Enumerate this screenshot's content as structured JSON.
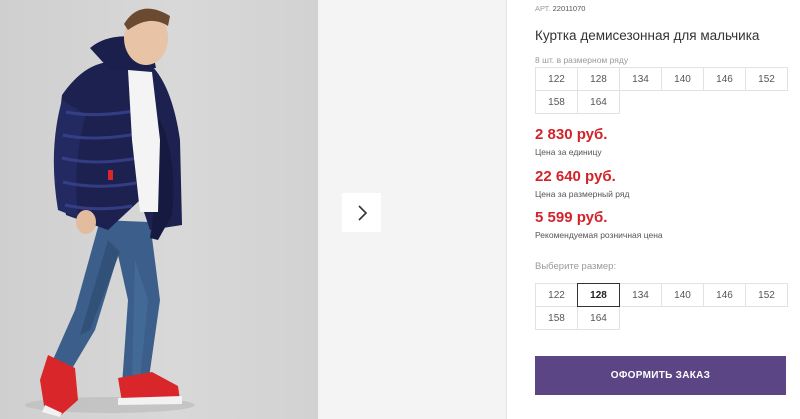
{
  "product": {
    "art_label": "АРТ.",
    "art_number": "22011070",
    "title": "Куртка демисезонная для мальчика",
    "series_note": "8 шт. в размерном ряду",
    "series_sizes": [
      "122",
      "128",
      "134",
      "140",
      "146",
      "152",
      "158",
      "164"
    ]
  },
  "prices": [
    {
      "value": "2 830 руб.",
      "label": "Цена за единицу"
    },
    {
      "value": "22 640 руб.",
      "label": "Цена за размерный ряд"
    },
    {
      "value": "5 599 руб.",
      "label": "Рекомендуемая розничная цена"
    }
  ],
  "size_picker": {
    "label": "Выберите размер:",
    "sizes": [
      "122",
      "128",
      "134",
      "140",
      "146",
      "152",
      "158",
      "164"
    ],
    "selected": "128"
  },
  "order_button": {
    "label": "ОФОРМИТЬ ЗАКАЗ"
  },
  "gallery": {
    "next_icon": "chevron-right-icon"
  },
  "colors": {
    "price": "#d2232a",
    "order_button": "#5c4585",
    "jacket": "#1c2150",
    "sneakers": "#d9262a"
  }
}
